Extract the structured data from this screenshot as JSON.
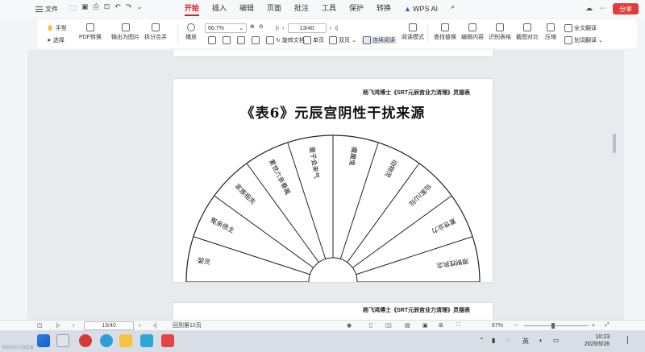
{
  "menubar": {
    "file_label": "文件",
    "tabs": [
      "开始",
      "插入",
      "编辑",
      "页面",
      "批注",
      "工具",
      "保护",
      "转换"
    ],
    "active_tab": "开始",
    "wps_ai_label": "WPS AI",
    "share_label": "分享"
  },
  "toolbar": {
    "hand_label": "手型",
    "select_label": "选择",
    "pdf_convert_label": "PDF转换",
    "export_image_label": "输出为图片",
    "split_merge_label": "拆分合并",
    "play_label": "播放",
    "zoom_value": "66.7%",
    "page_value": "13/40",
    "rotate_label": "旋转文档",
    "single_page_label": "单页",
    "double_page_label": "双页",
    "continuous_label": "连续阅读",
    "reading_mode_label": "阅读模式",
    "find_replace_label": "查找替换",
    "edit_content_label": "编辑内容",
    "recognize_table_label": "识别表格",
    "screenshot_compare_label": "截图对比",
    "compress_label": "压缩",
    "full_translate_label": "全文翻译",
    "word_translate_label": "划词翻译"
  },
  "document": {
    "header": "杨飞鸿博士《SRT元辰宫业力清理》灵摆表",
    "title": "《表6》元辰宫阴性干扰来源",
    "fan_segments": [
      "婴灵",
      "冤亲债主",
      "家族祖先",
      "累世六亲眷属",
      "童子会来气",
      "魔魔鬼",
      "动物灵",
      "仙家/山仙",
      "累世业力",
      "限制性执念"
    ],
    "next_header": "杨飞鸿博士《SRT元辰宫业力清理》灵摆表"
  },
  "statusbar": {
    "page_value": "13/40",
    "back_label": "回到第12页",
    "zoom_value": "67%"
  },
  "taskbar": {
    "time": "10:23",
    "date": "2025/5/26",
    "ime_label": "英",
    "caption": "杨老师的灵摆屏幕"
  }
}
